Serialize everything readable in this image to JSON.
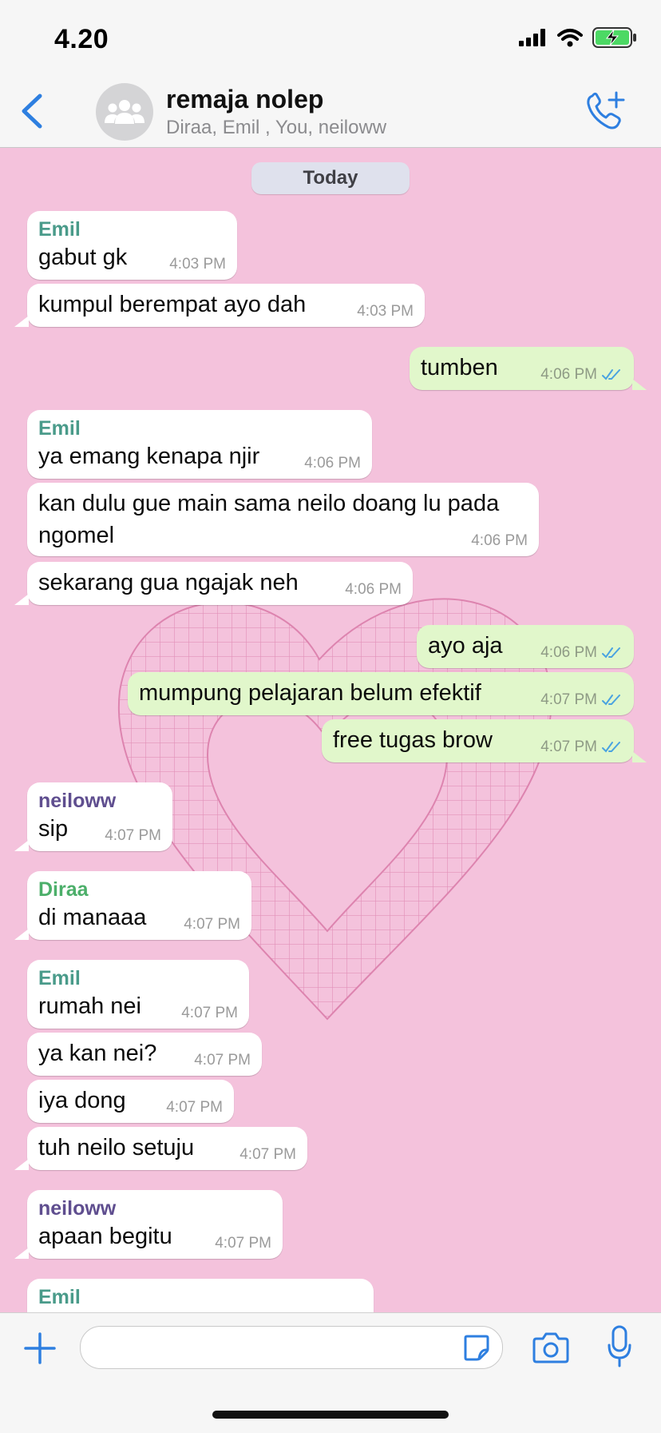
{
  "status_bar": {
    "time": "4.20",
    "icons": [
      "signal-icon",
      "wifi-icon",
      "battery-charging-icon"
    ]
  },
  "header": {
    "title": "remaja nolep",
    "subtitle": "Diraa, Emil  , You, neiloww",
    "icons": [
      "back-chevron-icon",
      "group-avatar-icon",
      "add-call-icon"
    ]
  },
  "chat": {
    "date_label": "Today",
    "colors": {
      "background": "#f4c2dc",
      "incoming": "#ffffff",
      "outgoing": "#e1f7cb",
      "emil": "#4a9b8a",
      "neiloww": "#5f4e8f",
      "diraa": "#4caf6a",
      "read_tick": "#4aa3e0"
    },
    "messages": [
      {
        "sender": "Emil",
        "text": "gabut gk",
        "time": "4:03 PM",
        "direction": "in"
      },
      {
        "sender": "",
        "text": "kumpul berempat ayo dah",
        "time": "4:03 PM",
        "direction": "in"
      },
      {
        "sender": "",
        "text": "tumben",
        "time": "4:06 PM",
        "direction": "out",
        "status": "read"
      },
      {
        "sender": "Emil",
        "text": "ya emang kenapa njir",
        "time": "4:06 PM",
        "direction": "in"
      },
      {
        "sender": "",
        "text": "kan dulu gue main sama neilo doang lu pada ngomel",
        "time": "4:06 PM",
        "direction": "in"
      },
      {
        "sender": "",
        "text": "sekarang gua ngajak neh",
        "time": "4:06 PM",
        "direction": "in"
      },
      {
        "sender": "",
        "text": "ayo aja",
        "time": "4:06 PM",
        "direction": "out",
        "status": "read"
      },
      {
        "sender": "",
        "text": "mumpung pelajaran belum efektif",
        "time": "4:07 PM",
        "direction": "out",
        "status": "read"
      },
      {
        "sender": "",
        "text": "free tugas brow",
        "time": "4:07 PM",
        "direction": "out",
        "status": "read"
      },
      {
        "sender": "neiloww",
        "text": "sip",
        "time": "4:07 PM",
        "direction": "in"
      },
      {
        "sender": "Diraa",
        "text": "di manaaa",
        "time": "4:07 PM",
        "direction": "in"
      },
      {
        "sender": "Emil",
        "text": "rumah nei",
        "time": "4:07 PM",
        "direction": "in"
      },
      {
        "sender": "",
        "text": "ya kan nei?",
        "time": "4:07 PM",
        "direction": "in"
      },
      {
        "sender": "",
        "text": "iya dong",
        "time": "4:07 PM",
        "direction": "in"
      },
      {
        "sender": "",
        "text": "tuh neilo setuju",
        "time": "4:07 PM",
        "direction": "in"
      },
      {
        "sender": "neiloww",
        "text": "apaan begitu",
        "time": "4:07 PM",
        "direction": "in"
      },
      {
        "sender": "Emil",
        "text": "",
        "time": "",
        "direction": "in"
      }
    ]
  },
  "composer": {
    "placeholder": "",
    "icons": [
      "plus-icon",
      "sticker-icon",
      "camera-icon",
      "microphone-icon"
    ]
  }
}
